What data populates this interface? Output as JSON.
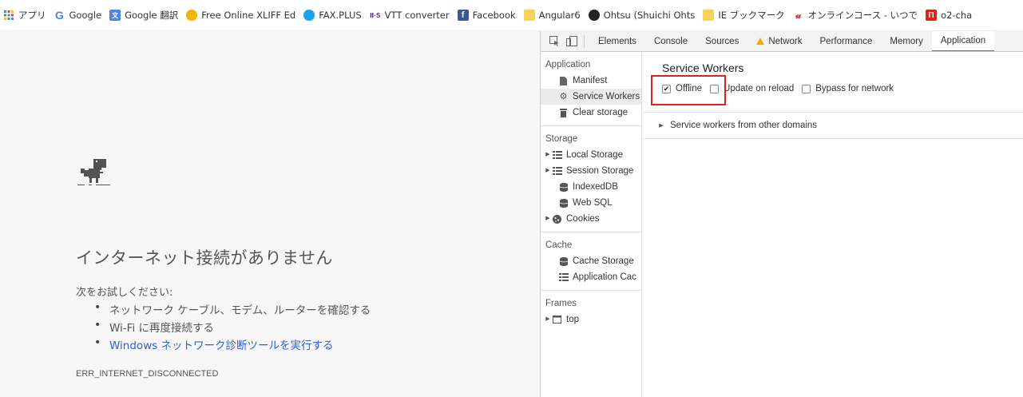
{
  "bookmarks": [
    {
      "icon": "apps-grid-icon",
      "label": "アプリ"
    },
    {
      "icon": "google-g-icon",
      "label": "Google"
    },
    {
      "icon": "google-translate-icon",
      "label": "Google 翻訳"
    },
    {
      "icon": "xliff-editor-icon",
      "label": "Free Online XLIFF Ed"
    },
    {
      "icon": "fax-plus-icon",
      "label": "FAX.PLUS"
    },
    {
      "icon": "vtt-converter-icon",
      "label": "VTT converter"
    },
    {
      "icon": "facebook-icon",
      "label": "Facebook"
    },
    {
      "icon": "folder-icon",
      "label": "Angular6"
    },
    {
      "icon": "github-icon",
      "label": "Ohtsu (Shuichi Ohts"
    },
    {
      "icon": "folder-icon",
      "label": "IE ブックマーク"
    },
    {
      "icon": "udemy-icon",
      "label": "オンラインコース - いつで"
    },
    {
      "icon": "o2-icon",
      "label": "o2-cha"
    }
  ],
  "page": {
    "error_title": "インターネット接続がありません",
    "suggest_heading": "次をお試しください:",
    "suggestions": [
      "ネットワーク ケーブル、モデム、ルーターを確認する",
      "Wi-Fi に再度接続する",
      "Windows ネットワーク診断ツールを実行する"
    ],
    "error_code": "ERR_INTERNET_DISCONNECTED"
  },
  "devtools": {
    "tabs": [
      "Elements",
      "Console",
      "Sources",
      "Network",
      "Performance",
      "Memory",
      "Application"
    ],
    "active_tab": "Application",
    "sidebar": {
      "application_title": "Application",
      "application_items": [
        "Manifest",
        "Service Workers",
        "Clear storage"
      ],
      "storage_title": "Storage",
      "storage_items": [
        "Local Storage",
        "Session Storage",
        "IndexedDB",
        "Web SQL",
        "Cookies"
      ],
      "cache_title": "Cache",
      "cache_items": [
        "Cache Storage",
        "Application Cac"
      ],
      "frames_title": "Frames",
      "frames_items": [
        "top"
      ]
    },
    "main": {
      "title": "Service Workers",
      "options": [
        {
          "label": "Offline",
          "checked": true
        },
        {
          "label": "Update on reload",
          "checked": false
        },
        {
          "label": "Bypass for network",
          "checked": false
        }
      ],
      "other_domains": "Service workers from other domains"
    }
  },
  "colors": {
    "link": "#2f5fcf",
    "highlight": "#e02020",
    "active_tab_underline": "#3879d9"
  }
}
